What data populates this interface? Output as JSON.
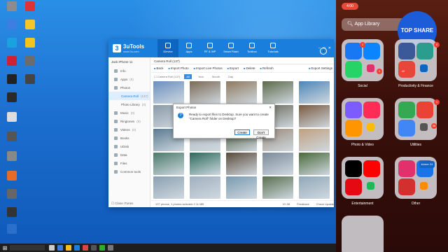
{
  "desktop": {
    "icons": [
      {
        "label": "",
        "color": "#8c8c8c"
      },
      {
        "label": "",
        "color": "#d33"
      },
      {
        "label": "",
        "color": "#3d7ee0"
      },
      {
        "label": "",
        "color": "#f3c62a"
      },
      {
        "label": "",
        "color": "#1aa1e0"
      },
      {
        "label": "",
        "color": "#f2c41d"
      },
      {
        "label": "",
        "color": "#c23"
      },
      {
        "label": "",
        "color": "#6c6c6c"
      },
      {
        "label": "",
        "color": "#222"
      },
      {
        "label": "",
        "color": "#444"
      },
      {
        "label": "",
        "color": "#2a2a2a"
      },
      {
        "label": "",
        "color": "#ddd"
      },
      {
        "label": "",
        "color": "#555"
      },
      {
        "label": "",
        "color": "#888"
      },
      {
        "label": "",
        "color": "#e36c2b"
      },
      {
        "label": "",
        "color": "#666"
      },
      {
        "label": "",
        "color": "#333"
      },
      {
        "label": "",
        "color": "#2a6fc9"
      }
    ]
  },
  "taskbar": {
    "tray_text": ""
  },
  "window": {
    "app_title": "3uTools",
    "app_subtitle": "www.3u.com",
    "nav": [
      "iDevice",
      "Apps",
      "RT & WP",
      "Smart Flash",
      "Toolbox",
      "Tutorials"
    ],
    "device": "Jack iPhone 11",
    "sidebar": [
      {
        "label": "Info",
        "count": ""
      },
      {
        "label": "Apps",
        "count": "(0)"
      },
      {
        "label": "Photos",
        "count": ""
      },
      {
        "label": "Camera Roll",
        "count": "(137)",
        "sub": true,
        "active": true
      },
      {
        "label": "Photo Library",
        "count": "(0)",
        "sub": true
      },
      {
        "label": "Music",
        "count": "(0)"
      },
      {
        "label": "Ringtones",
        "count": "(0)"
      },
      {
        "label": "Videos",
        "count": "(0)"
      },
      {
        "label": "Books",
        "count": ""
      },
      {
        "label": "UDisk",
        "count": ""
      },
      {
        "label": "Data",
        "count": ""
      },
      {
        "label": "Files",
        "count": ""
      },
      {
        "label": "Common tools",
        "count": ""
      }
    ],
    "sidebar_footer": "Close iTunes",
    "main_tab": "Camera Roll (137)",
    "toolbar": [
      "Back",
      "Import Photo",
      "Import Live Photos",
      "Export",
      "Delete",
      "Refresh",
      "Export Settings"
    ],
    "filter_checkbox": "Camera Roll (137)",
    "filters": [
      "All",
      "Year",
      "Month",
      "Day"
    ],
    "status_text": "137 photos, 1 photos selected 2.11 MB",
    "version": "V2.58",
    "feedback": "Feedback",
    "check_update": "Check Update"
  },
  "dialog": {
    "title": "Export Photos",
    "message": "Ready to export files to Desktop. Sure you want to create \"Camera Roll\" folder on Desktop?",
    "create": "Create",
    "dont_create": "Don't Create"
  },
  "phone": {
    "time": "4:00",
    "search_placeholder": "App Library",
    "brand": "TOP SHARE",
    "folders": [
      {
        "label": "Social"
      },
      {
        "label": "Productivity & Finance"
      },
      {
        "label": "Photo & Video"
      },
      {
        "label": "Utilities"
      },
      {
        "label": "Entertainment"
      },
      {
        "label": "Other"
      }
    ],
    "badges": [
      "1",
      "1",
      "6",
      "42",
      "1",
      "36"
    ],
    "khmer_label": "khmer 24"
  },
  "photo_colors": [
    "#6a8fc0",
    "#7b6a55",
    "#8e7a5f",
    "#5d6a4a",
    "#4d86b8",
    "#8a9aa8",
    "#3c5a80",
    "#a07a60",
    "#6a6a5a",
    "#7a5a40",
    "#5a7a90",
    "#b0b8c0",
    "#4a5a3a",
    "#9a8a7a",
    "#c0a080",
    "#4a7a6a",
    "#2a6a5a",
    "#5a4a3a",
    "#7a8a9a",
    "#4a6a3a",
    "#8aa0b0",
    "#a0b0c0",
    "#7a9ab0",
    "#5a7050",
    "#90a8b8"
  ]
}
